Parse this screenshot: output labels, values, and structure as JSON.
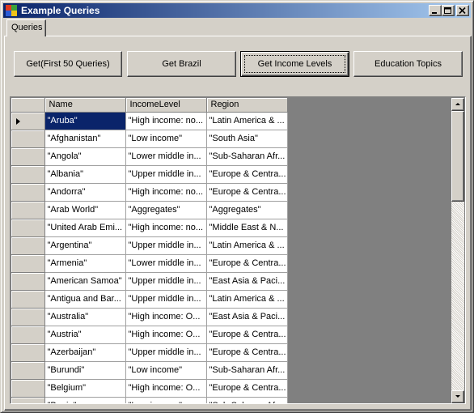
{
  "window": {
    "title": "Example Queries"
  },
  "tabs": [
    {
      "label": "Queries"
    }
  ],
  "buttons": [
    {
      "label": "Get(First 50 Queries)"
    },
    {
      "label": "Get Brazil"
    },
    {
      "label": "Get Income Levels"
    },
    {
      "label": "Education Topics"
    }
  ],
  "grid": {
    "columns": [
      "Name",
      "IncomeLevel",
      "Region"
    ],
    "selected_row": 0,
    "rows": [
      [
        "\"Aruba\"",
        "\"High income: no...",
        "\"Latin America & ..."
      ],
      [
        "\"Afghanistan\"",
        "\"Low income\"",
        "\"South Asia\""
      ],
      [
        "\"Angola\"",
        "\"Lower middle in...",
        "\"Sub-Saharan Afr..."
      ],
      [
        "\"Albania\"",
        "\"Upper middle in...",
        "\"Europe & Centra..."
      ],
      [
        "\"Andorra\"",
        "\"High income: no...",
        "\"Europe & Centra..."
      ],
      [
        "\"Arab World\"",
        "\"Aggregates\"",
        "\"Aggregates\""
      ],
      [
        "\"United Arab Emi...",
        "\"High income: no...",
        "\"Middle East & N..."
      ],
      [
        "\"Argentina\"",
        "\"Upper middle in...",
        "\"Latin America & ..."
      ],
      [
        "\"Armenia\"",
        "\"Lower middle in...",
        "\"Europe & Centra..."
      ],
      [
        "\"American Samoa\"",
        "\"Upper middle in...",
        "\"East Asia & Paci..."
      ],
      [
        "\"Antigua and Bar...",
        "\"Upper middle in...",
        "\"Latin America & ..."
      ],
      [
        "\"Australia\"",
        "\"High income: O...",
        "\"East Asia & Paci..."
      ],
      [
        "\"Austria\"",
        "\"High income: O...",
        "\"Europe & Centra..."
      ],
      [
        "\"Azerbaijan\"",
        "\"Upper middle in...",
        "\"Europe & Centra..."
      ],
      [
        "\"Burundi\"",
        "\"Low income\"",
        "\"Sub-Saharan Afr..."
      ],
      [
        "\"Belgium\"",
        "\"High income: O...",
        "\"Europe & Centra..."
      ],
      [
        "\"Benin\"",
        "\"Low income\"",
        "\"Sub-Saharan Afr..."
      ]
    ]
  },
  "icons": {
    "app": "windows-flag-icon",
    "minimize": "minimize-icon",
    "maximize": "maximize-icon",
    "close": "close-icon",
    "row_pointer": "row-pointer-icon",
    "scroll_up": "arrow-up-icon",
    "scroll_down": "arrow-down-icon"
  },
  "colors": {
    "title_start": "#0a246a",
    "title_end": "#a6caf0",
    "selection": "#0a246a",
    "face": "#d4d0c8",
    "grid_bg": "#808080"
  }
}
